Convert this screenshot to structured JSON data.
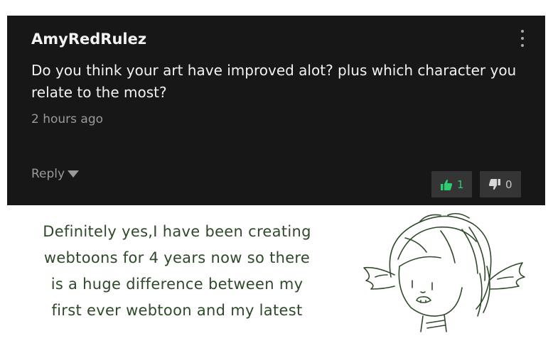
{
  "comment": {
    "username": "AmyRedRulez",
    "text": "Do you think your art have improved alot? plus which character you relate to the most?",
    "timestamp": "2 hours ago",
    "reply_label": "Reply",
    "likes": "1",
    "dislikes": "0"
  },
  "answer": {
    "lines": [
      "Definitely yes,I have been creating",
      "webtoons for 4 years now so there",
      "is a huge difference between my",
      "first ever webtoon and my latest"
    ]
  },
  "colors": {
    "card_bg": "#171717",
    "like_green": "#2ecc71",
    "handwriting": "#2f4a2a"
  },
  "icons": [
    "more-vert-icon",
    "caret-down-icon",
    "thumbs-up-icon",
    "thumbs-down-icon"
  ]
}
